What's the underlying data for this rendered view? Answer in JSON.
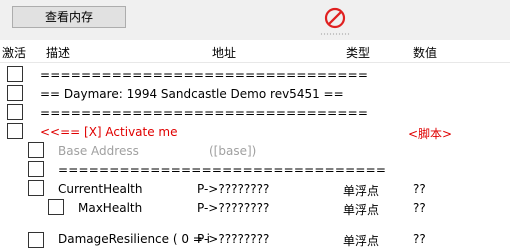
{
  "toolbar": {
    "memory_view_label": "查看内存",
    "stop_icon": "no-entry-icon"
  },
  "columns": {
    "active": "激活",
    "description": "描述",
    "address": "地址",
    "type": "类型",
    "value": "数值"
  },
  "rows": [
    {
      "description": "================================"
    },
    {
      "description": "==  Daymare: 1994 Sandcastle Demo  rev5451  =="
    },
    {
      "description": "================================"
    },
    {
      "description": "<<== [X]  Activate me",
      "value": "<脚本>"
    },
    {
      "description": "Base Address",
      "address": "([base])"
    },
    {
      "description": "================================"
    },
    {
      "description": "CurrentHealth",
      "address": "P->????????",
      "type": "单浮点",
      "value": "??"
    },
    {
      "description": "MaxHealth",
      "address": "P->????????",
      "type": "单浮点",
      "value": "??"
    },
    {
      "description": "DamageResilience ( 0 = i",
      "address": "P->????????",
      "type": "单浮点",
      "value": "??"
    }
  ],
  "colors": {
    "script_text": "#e00000",
    "disabled_text": "#a0a0a0"
  }
}
